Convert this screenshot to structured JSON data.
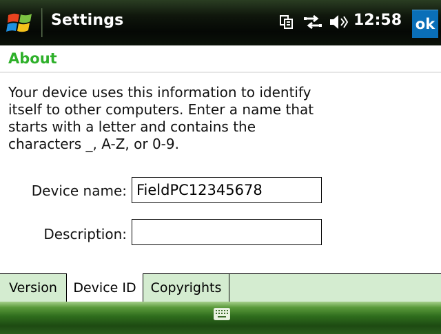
{
  "window": {
    "title": "Settings",
    "clock": "12:58",
    "ok_label": "ok",
    "status_icons": [
      "sync-icon",
      "connectivity-icon",
      "volume-icon"
    ]
  },
  "page": {
    "title": "About",
    "description": "Your device uses this information to identify itself to other computers. Enter a name that starts with a letter and contains the characters _, A-Z, or 0-9."
  },
  "form": {
    "device_name_label": "Device name:",
    "device_name_value": "FieldPC12345678",
    "description_label": "Description:",
    "description_value": ""
  },
  "tabs": [
    {
      "label": "Version",
      "active": false
    },
    {
      "label": "Device ID",
      "active": true
    },
    {
      "label": "Copyrights",
      "active": false
    }
  ],
  "bottombar": {
    "keyboard_icon": "keyboard-icon"
  },
  "colors": {
    "accent_green": "#2eb02a",
    "ok_blue": "#0a6fb8",
    "tab_background": "#d4ecd0"
  }
}
